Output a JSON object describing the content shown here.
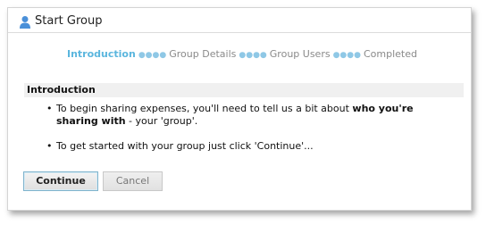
{
  "window": {
    "title": "Start Group",
    "icon": "user-icon"
  },
  "steps": [
    {
      "label": "Introduction",
      "active": true
    },
    {
      "label": "Group Details",
      "active": false
    },
    {
      "label": "Group Users",
      "active": false
    },
    {
      "label": "Completed",
      "active": false
    }
  ],
  "step_separator": "●●●●",
  "section": {
    "title": "Introduction"
  },
  "bullets": {
    "item1_text_before": "To begin sharing expenses, you'll need to tell us a bit about ",
    "item1_text_bold": "who you're sharing with",
    "item1_text_after": " - your 'group'.",
    "item2_text": "To get started with your group just click 'Continue'..."
  },
  "buttons": {
    "continue_label": "Continue",
    "cancel_label": "Cancel"
  },
  "colors": {
    "active_step": "#5bb6de",
    "inactive_step": "#8a8a8a",
    "separator_dots": "#8fc8e6",
    "section_header_bg": "#f0f0f0"
  }
}
